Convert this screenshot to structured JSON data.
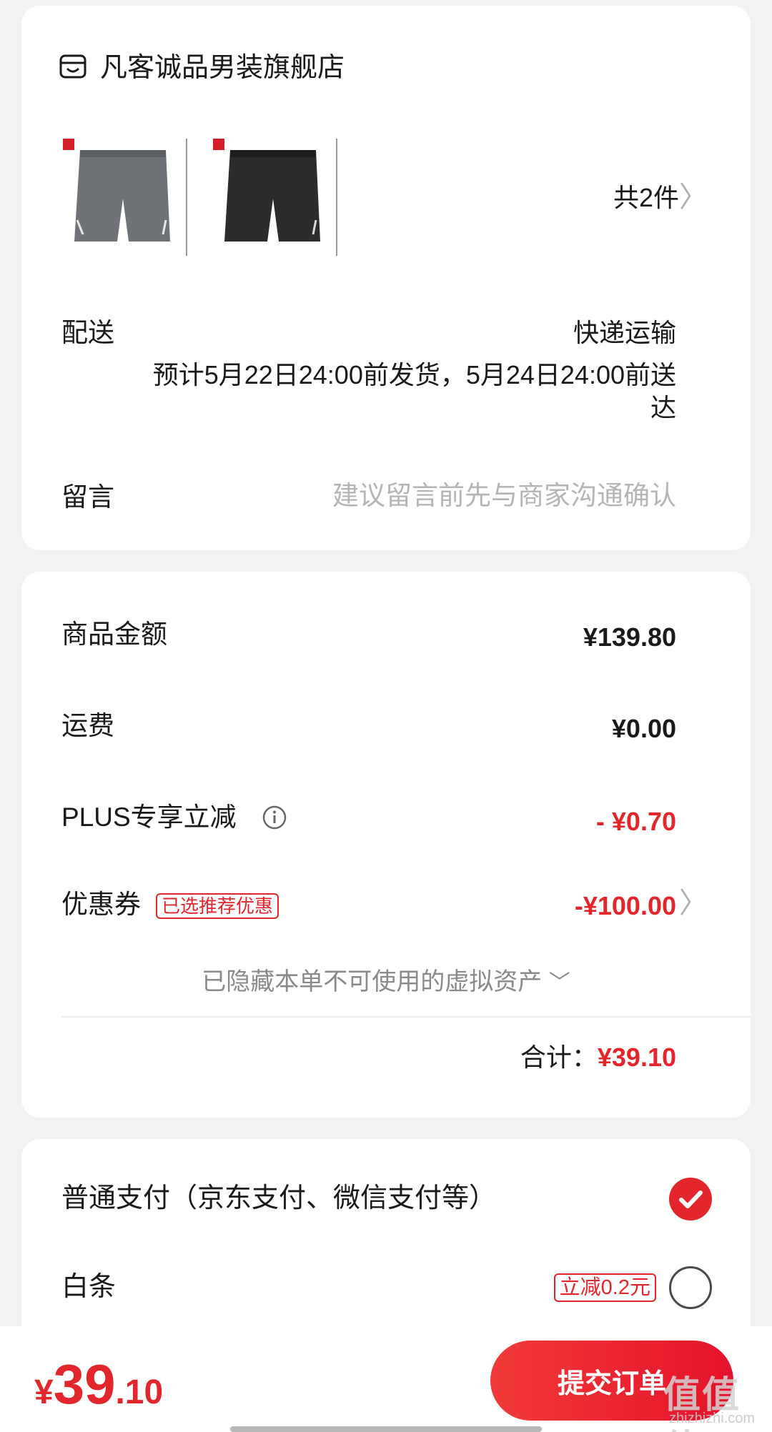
{
  "store": {
    "icon": "store-icon",
    "name": "凡客诚品男装旗舰店",
    "items": [
      {
        "name": "grey shorts thumbnail",
        "color": "#6f7378"
      },
      {
        "name": "black shorts thumbnail",
        "color": "#2b2c2e"
      }
    ],
    "count_label": "共2件",
    "chevron": "〉"
  },
  "delivery": {
    "label": "配送",
    "method": "快递运输",
    "eta": "预计5月22日24:00前发货，5月24日24:00前送达"
  },
  "message": {
    "label": "留言",
    "placeholder": "建议留言前先与商家沟通确认"
  },
  "price": {
    "goods_label": "商品金额",
    "goods_value": "¥139.80",
    "shipping_label": "运费",
    "shipping_value": "¥0.00",
    "plus_label": "PLUS专享立减",
    "plus_value": "- ¥0.70",
    "coupon_label": "优惠券",
    "coupon_tag": "已选推荐优惠",
    "coupon_value": "-¥100.00",
    "coupon_chevron": "〉",
    "hidden_assets": "已隐藏本单不可使用的虚拟资产",
    "hidden_chevron": "﹀",
    "total_label": "合计：",
    "total_value": "¥39.10"
  },
  "payment": {
    "normal_label": "普通支付（京东支付、微信支付等）",
    "normal_selected": true,
    "baitiao_label": "白条",
    "baitiao_tag": "立减0.2元",
    "baitiao_selected": false
  },
  "bottom": {
    "yen": "¥",
    "total_int": "39",
    "total_dec": ".10",
    "submit_label": "提交订单",
    "watermark": "值值值",
    "watermark_sub": "zhizhizhi.com"
  },
  "colors": {
    "accent": "#e3262b",
    "muted": "#b5b5b5"
  }
}
